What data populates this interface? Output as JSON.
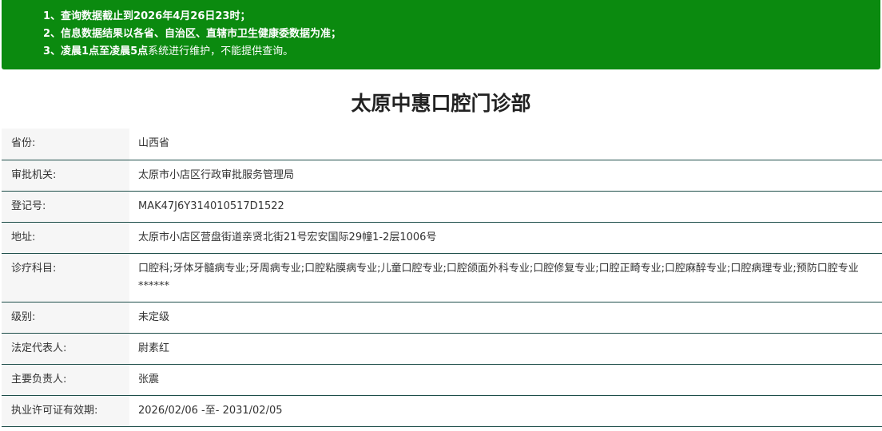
{
  "notice": {
    "line1": {
      "prefix": "1、查询数据截止到",
      "date": "2026年4月26日23时",
      "suffix": "；"
    },
    "line2": "2、信息数据结果以各省、自治区、直辖市卫生健康委数据为准；",
    "line3": {
      "prefix": "3、",
      "highlight": "凌晨1点至凌晨5点",
      "suffix": "系统进行维护，不能提供查询。"
    }
  },
  "title": "太原中惠口腔门诊部",
  "rows": [
    {
      "label": "省份:",
      "value": "山西省"
    },
    {
      "label": "审批机关:",
      "value": "太原市小店区行政审批服务管理局"
    },
    {
      "label": "登记号:",
      "value": "MAK47J6Y314010517D1522"
    },
    {
      "label": "地址:",
      "value": "太原市小店区营盘街道亲贤北街21号宏安国际29幢1-2层1006号"
    },
    {
      "label": "诊疗科目:",
      "value": "口腔科;牙体牙髓病专业;牙周病专业;口腔粘膜病专业;儿童口腔专业;口腔颌面外科专业;口腔修复专业;口腔正畸专业;口腔麻醉专业;口腔病理专业;预防口腔专业******"
    },
    {
      "label": "级别:",
      "value": "未定级"
    },
    {
      "label": "法定代表人:",
      "value": "尉素红"
    },
    {
      "label": "主要负责人:",
      "value": "张震"
    },
    {
      "label": "执业许可证有效期:",
      "value": "2026/02/06 -至- 2031/02/05"
    }
  ]
}
